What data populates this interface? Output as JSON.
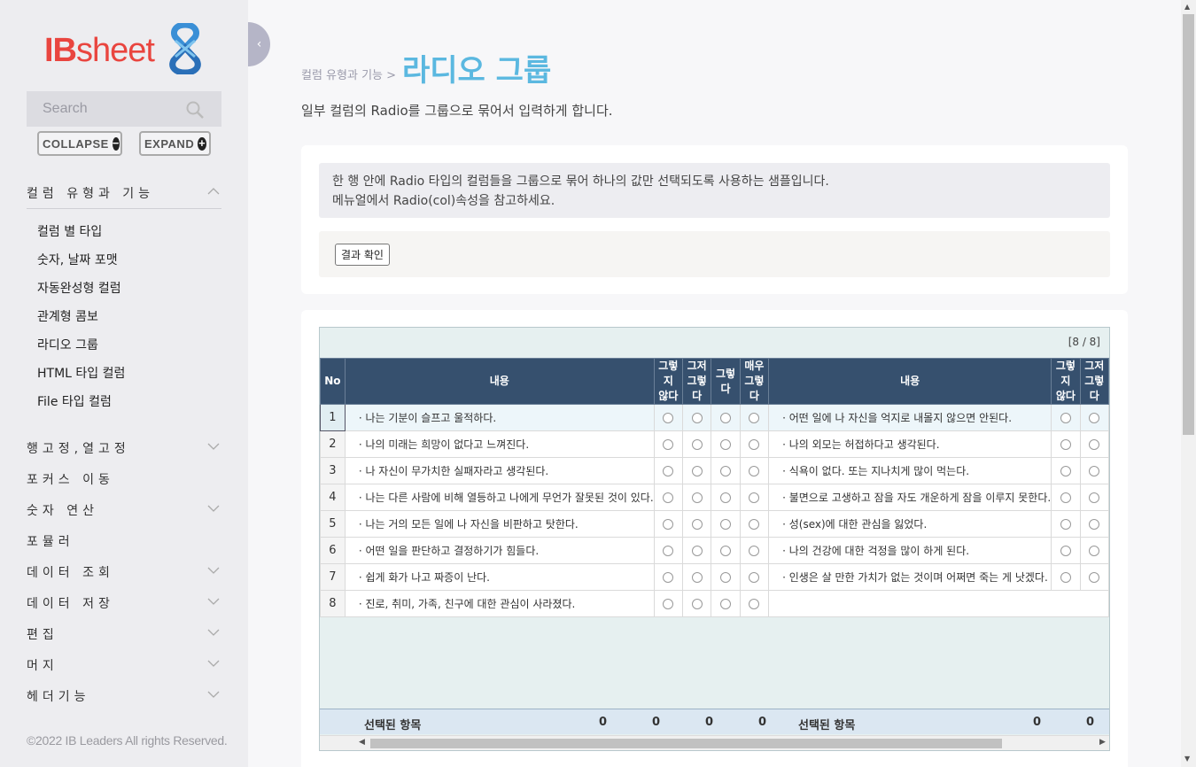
{
  "sidebar": {
    "logo_ib": "IB",
    "logo_sheet": "sheet",
    "search_placeholder": "Search",
    "collapse_label": "COLLAPSE",
    "expand_label": "EXPAND",
    "groups": [
      {
        "label": "컬럼 유형과 기능"
      },
      {
        "label": "행고정,열고정"
      },
      {
        "label": "포커스 이동"
      },
      {
        "label": "숫자 연산"
      },
      {
        "label": "포뮬러"
      },
      {
        "label": "데이터 조회"
      },
      {
        "label": "데이터 저장"
      },
      {
        "label": "편집"
      },
      {
        "label": "머지"
      },
      {
        "label": "헤더기능"
      }
    ],
    "sub_items": [
      "컬럼 별 타입",
      "숫자, 날짜 포맷",
      "자동완성형 컬럼",
      "관계형 콤보",
      "라디오 그룹",
      "HTML 타입 컬럼",
      "File 타입 컬럼"
    ],
    "copyright": "©2022 IB Leaders All rights Reserved."
  },
  "header": {
    "breadcrumb": "컬럼 유형과 기능 >",
    "title": "라디오 그룹",
    "description": "일부 컬럼의 Radio를 그룹으로 묶어서 입력하게 합니다."
  },
  "info": {
    "line1": "한 행 안에 Radio 타입의 컬럼들을 그룹으로 묶어 하나의 값만 선택되도록 사용하는 샘플입니다.",
    "line2": "메뉴얼에서 Radio(col)속성을 참고하세요."
  },
  "actions": {
    "result_button": "결과 확인"
  },
  "grid": {
    "count": "[8 / 8]",
    "headers": {
      "no": "No",
      "content": "내용",
      "opt1_a": "그렇지",
      "opt1_b": "않다",
      "opt2_a": "그저",
      "opt2_b": "그렇다",
      "opt3": "그렇다",
      "opt4_a": "매우",
      "opt4_b": "그렇다",
      "content2": "내용",
      "opt5_a": "그렇지",
      "opt5_b": "않다",
      "opt6_a": "그저",
      "opt6_b": "그렇다"
    },
    "rows": [
      {
        "no": "1",
        "left": "· 나는 기분이 슬프고 울적하다.",
        "right": "· 어떤 일에 나 자신을 억지로 내몰지 않으면 안된다."
      },
      {
        "no": "2",
        "left": "· 나의 미래는 희망이 없다고 느껴진다.",
        "right": "· 나의 외모는 허접하다고 생각된다."
      },
      {
        "no": "3",
        "left": "· 나 자신이 무가치한 실패자라고 생각된다.",
        "right": "· 식욕이 없다. 또는 지나치게 많이 먹는다."
      },
      {
        "no": "4",
        "left": "· 나는 다른 사람에 비해 열등하고 나에게 무언가 잘못된 것이 있다.",
        "right": "· 불면으로 고생하고 잠을 자도 개운하게 잠을 이루지 못한다."
      },
      {
        "no": "5",
        "left": "· 나는 거의 모든 일에 나 자신을 비판하고 탓한다.",
        "right": "· 성(sex)에 대한 관심을 잃었다."
      },
      {
        "no": "6",
        "left": "· 어떤 일을 판단하고 결정하기가 힘들다.",
        "right": "· 나의 건강에 대한 걱정을 많이 하게 된다."
      },
      {
        "no": "7",
        "left": "· 쉽게 화가 나고 짜증이 난다.",
        "right": "· 인생은 살 만한 가치가 없는 것이며 어쩌면 죽는 게 낫겠다."
      },
      {
        "no": "8",
        "left": "· 진로, 취미, 가족, 친구에 대한 관심이 사라졌다.",
        "right": ""
      }
    ],
    "footer": {
      "label1": "선택된 항목",
      "v1": "0",
      "v2": "0",
      "v3": "0",
      "v4": "0",
      "label2": "선택된 항목",
      "v5": "0",
      "v6": "0"
    }
  }
}
